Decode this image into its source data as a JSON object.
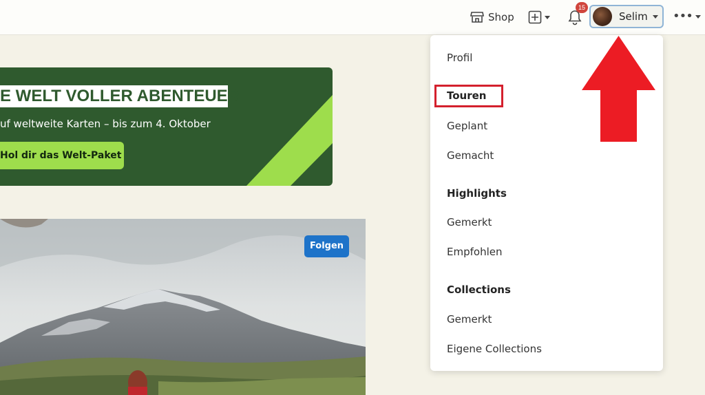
{
  "header": {
    "shop_label": "Shop",
    "notification_count": "15",
    "user_name": "Selim"
  },
  "banner": {
    "title": "E WELT VOLLER ABENTEUER",
    "subtitle": "uf weltweite Karten – bis zum 4. Oktober",
    "cta_label": "Hol dir das Welt-Paket"
  },
  "photo": {
    "follow_label": "Folgen"
  },
  "menu": {
    "profil": "Profil",
    "touren_header": "Touren",
    "geplant": "Geplant",
    "gemacht": "Gemacht",
    "highlights_header": "Highlights",
    "highlights_gemerkt": "Gemerkt",
    "empfohlen": "Empfohlen",
    "collections_header": "Collections",
    "collections_gemerkt": "Gemerkt",
    "eigene_collections": "Eigene Collections"
  },
  "colors": {
    "banner_green": "#2f5a2e",
    "lime": "#9edd4c",
    "follow_blue": "#1e73c9",
    "annotation_red": "#d4202d"
  }
}
